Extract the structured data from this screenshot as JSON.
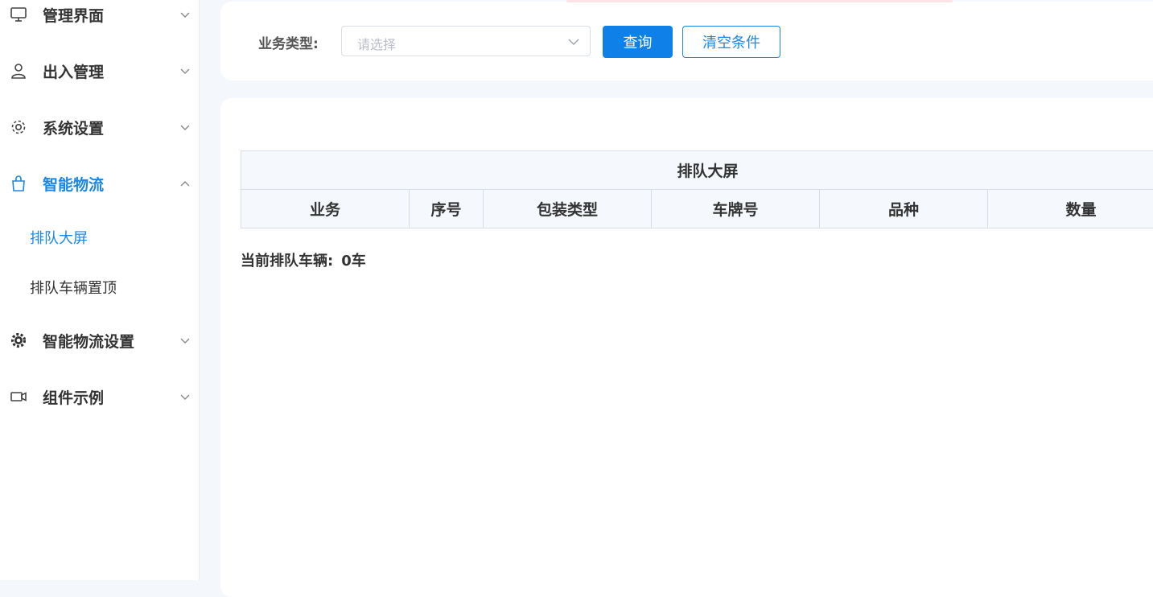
{
  "sidebar": {
    "menu": [
      {
        "label": "管理界面",
        "icon": "monitor-icon"
      },
      {
        "label": "出入管理",
        "icon": "user-icon"
      },
      {
        "label": "系统设置",
        "icon": "gear-outline-icon"
      },
      {
        "label": "智能物流",
        "icon": "shopping-bag-icon",
        "active": true,
        "children": [
          {
            "label": "排队大屏",
            "active": true
          },
          {
            "label": "排队车辆置顶"
          }
        ]
      },
      {
        "label": "智能物流设置",
        "icon": "gear-filled-icon"
      },
      {
        "label": "组件示例",
        "icon": "video-camera-icon"
      }
    ]
  },
  "filter": {
    "label": "业务类型:",
    "select_placeholder": "请选择",
    "query_button": "查询",
    "clear_button": "清空条件"
  },
  "table": {
    "title": "排队大屏",
    "columns": [
      "业务",
      "序号",
      "包装类型",
      "车牌号",
      "品种",
      "数量"
    ]
  },
  "queue": {
    "label": "当前排队车辆:",
    "value": "0车"
  },
  "colors": {
    "accent": "#1a87e8",
    "primary_button": "#0f80e8",
    "background": "#f4f7fb"
  }
}
